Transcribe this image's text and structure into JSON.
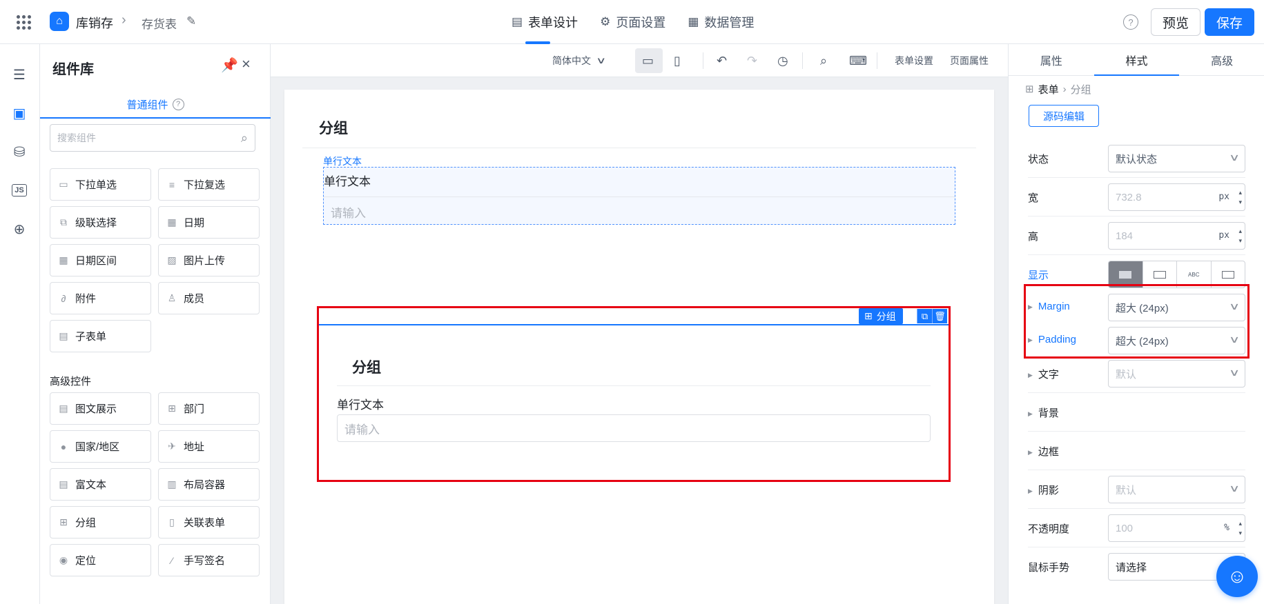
{
  "header": {
    "app_name": "库销存",
    "page_name": "存货表",
    "tabs": [
      {
        "label": "表单设计",
        "icon": "document-icon"
      },
      {
        "label": "页面设置",
        "icon": "gear-icon"
      },
      {
        "label": "数据管理",
        "icon": "table-icon"
      }
    ],
    "preview_label": "预览",
    "save_label": "保存",
    "help": "?"
  },
  "library": {
    "title": "组件库",
    "tab_label": "普通组件",
    "search_placeholder": "搜索组件",
    "basic_items": [
      {
        "label": "下拉单选",
        "icon": "select-icon"
      },
      {
        "label": "下拉复选",
        "icon": "checklist-icon"
      },
      {
        "label": "级联选择",
        "icon": "cascade-icon"
      },
      {
        "label": "日期",
        "icon": "calendar-icon"
      },
      {
        "label": "日期区间",
        "icon": "calendar-range-icon"
      },
      {
        "label": "图片上传",
        "icon": "image-icon"
      },
      {
        "label": "附件",
        "icon": "paperclip-icon"
      },
      {
        "label": "成员",
        "icon": "user-icon"
      },
      {
        "label": "子表单",
        "icon": "subform-icon"
      }
    ],
    "advanced_title": "高级控件",
    "advanced_items": [
      {
        "label": "图文展示",
        "icon": "text-image-icon"
      },
      {
        "label": "部门",
        "icon": "department-icon"
      },
      {
        "label": "国家/地区",
        "icon": "globe-icon"
      },
      {
        "label": "地址",
        "icon": "address-icon"
      },
      {
        "label": "富文本",
        "icon": "richtext-icon"
      },
      {
        "label": "布局容器",
        "icon": "layout-icon"
      },
      {
        "label": "分组",
        "icon": "group-icon"
      },
      {
        "label": "关联表单",
        "icon": "link-form-icon"
      },
      {
        "label": "定位",
        "icon": "location-icon"
      },
      {
        "label": "手写签名",
        "icon": "signature-icon"
      }
    ]
  },
  "toolbar": {
    "language": "简体中文",
    "form_settings": "表单设置",
    "page_props": "页面属性"
  },
  "canvas": {
    "group1_title": "分组",
    "field1_tag": "单行文本",
    "field1_label": "单行文本",
    "field1_placeholder": "请输入",
    "selected_tag": "分组",
    "group2_title": "分组",
    "group2_label": "单行文本",
    "group2_placeholder": "请输入"
  },
  "props": {
    "tabs": [
      "属性",
      "样式",
      "高级"
    ],
    "active_tab": "样式",
    "crumb_root": "表单",
    "crumb_current": "分组",
    "source_edit": "源码编辑",
    "state_label": "状态",
    "state_value": "默认状态",
    "width_label": "宽",
    "width_value": "732.8",
    "height_label": "高",
    "height_value": "184",
    "unit_px": "px",
    "display_label": "显示",
    "display_options": [
      "ABC",
      "ABC"
    ],
    "margin_label": "Margin",
    "margin_value": "超大 (24px)",
    "padding_label": "Padding",
    "padding_value": "超大 (24px)",
    "text_label": "文字",
    "text_value": "默认",
    "bg_label": "背景",
    "border_label": "边框",
    "shadow_label": "阴影",
    "shadow_value": "默认",
    "opacity_label": "不透明度",
    "opacity_value": "100",
    "unit_pct": "%",
    "cursor_label": "鼠标手势",
    "cursor_value": "请选择"
  },
  "colors": {
    "accent": "#1677ff",
    "highlight": "#e60012"
  }
}
